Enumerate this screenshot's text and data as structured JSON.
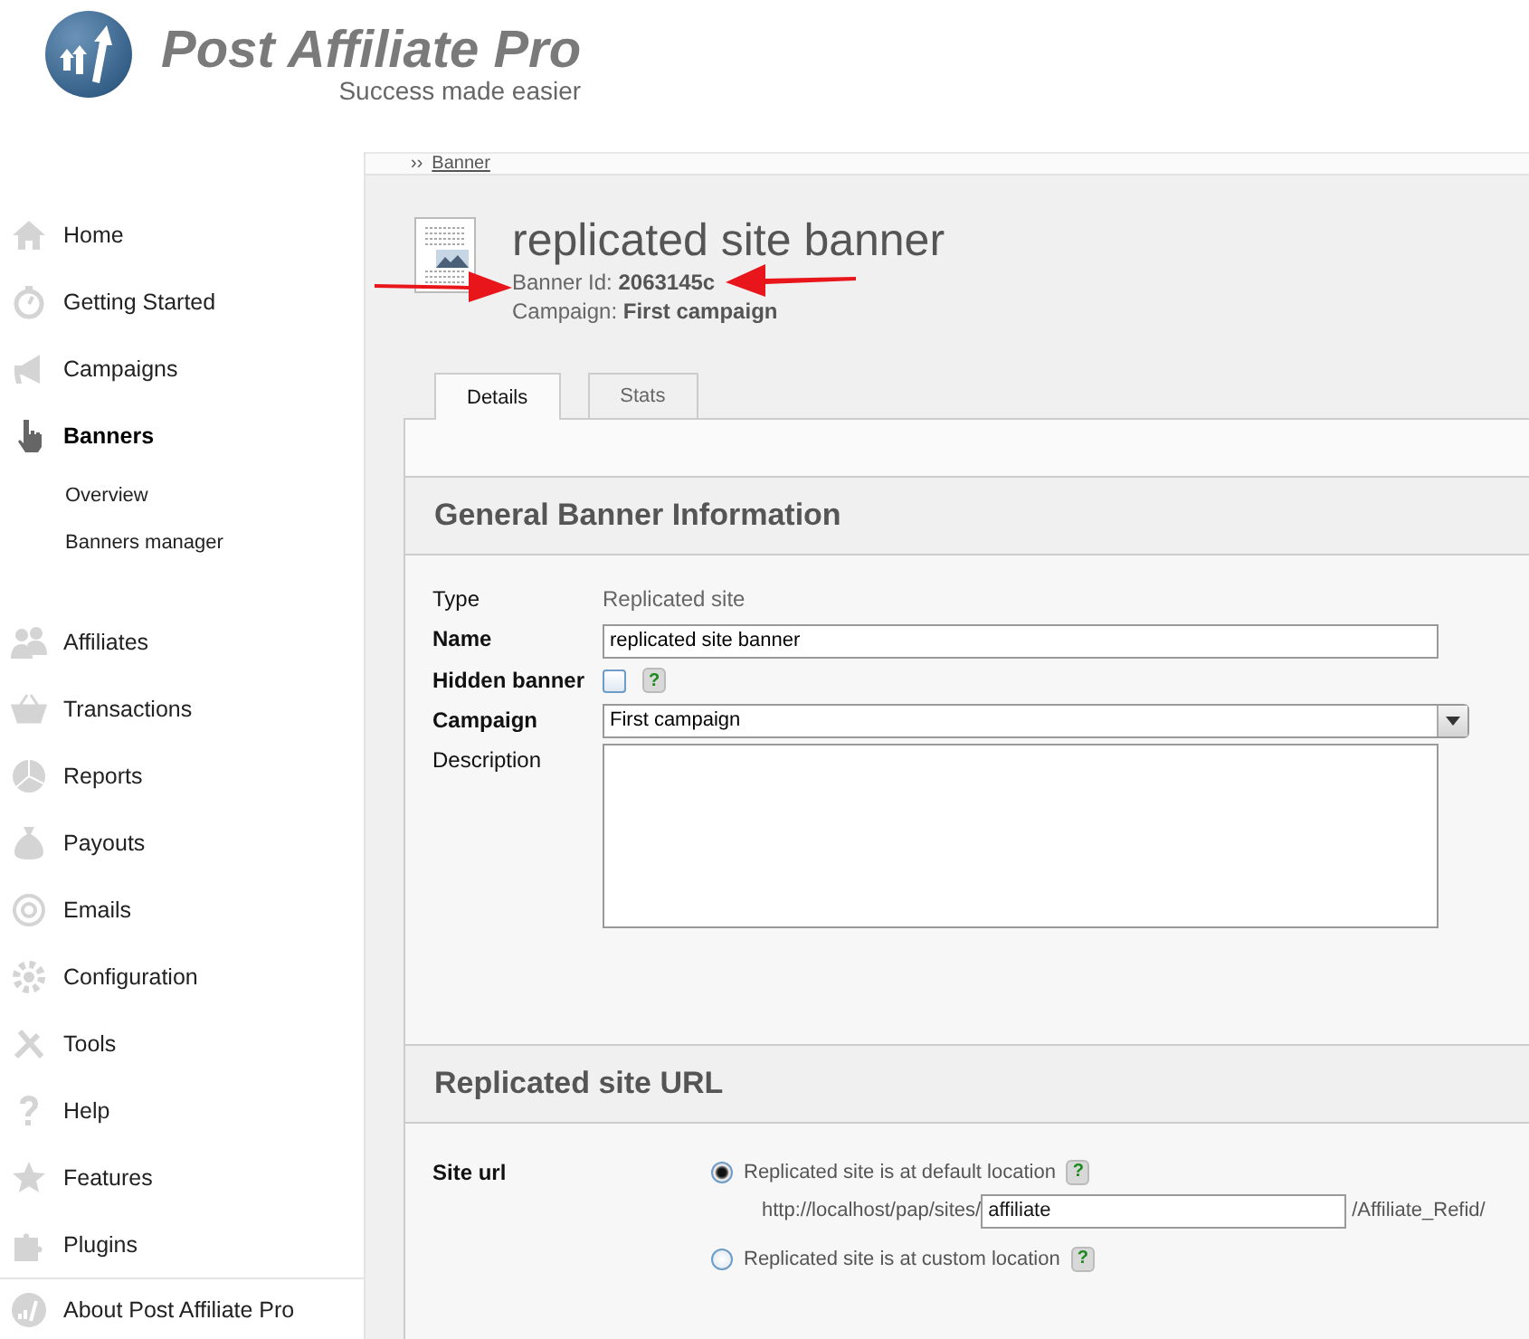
{
  "logo": {
    "title": "Post Affiliate Pro",
    "tagline": "Success made easier"
  },
  "sidebar": {
    "items": [
      {
        "label": "Home",
        "selected": false
      },
      {
        "label": "Getting Started",
        "selected": false
      },
      {
        "label": "Campaigns",
        "selected": false
      },
      {
        "label": "Banners",
        "selected": true,
        "expanded": true,
        "children": [
          {
            "label": "Overview"
          },
          {
            "label": "Banners manager"
          }
        ]
      },
      {
        "label": "Affiliates",
        "selected": false
      },
      {
        "label": "Transactions",
        "selected": false
      },
      {
        "label": "Reports",
        "selected": false
      },
      {
        "label": "Payouts",
        "selected": false
      },
      {
        "label": "Emails",
        "selected": false
      },
      {
        "label": "Configuration",
        "selected": false
      },
      {
        "label": "Tools",
        "selected": false
      },
      {
        "label": "Help",
        "selected": false
      },
      {
        "label": "Features",
        "selected": false
      },
      {
        "label": "Plugins",
        "selected": false
      }
    ],
    "footer_item": "About Post Affiliate Pro"
  },
  "breadcrumb": {
    "separator": "››",
    "link": "Banner"
  },
  "banner": {
    "title": "replicated site banner",
    "id_label": "Banner Id:",
    "id": "2063145c",
    "campaign_label": "Campaign:",
    "campaign": "First campaign"
  },
  "tabs": [
    {
      "label": "Details",
      "selected": true
    },
    {
      "label": "Stats",
      "selected": false
    }
  ],
  "sections": [
    {
      "title": "General Banner Information",
      "fields": [
        {
          "kind": "static",
          "label": "Type",
          "required": false,
          "value": "Replicated site"
        },
        {
          "kind": "text",
          "label": "Name",
          "required": true,
          "value": "replicated site banner"
        },
        {
          "kind": "checkbox",
          "label": "Hidden banner",
          "required": true,
          "checked": false,
          "help": "?"
        },
        {
          "kind": "select",
          "label": "Campaign",
          "required": true,
          "value": "First campaign"
        },
        {
          "kind": "textarea",
          "label": "Description",
          "required": false
        }
      ]
    },
    {
      "title": "Replicated site URL",
      "fields": [
        {
          "kind": "radios",
          "label": "Site url",
          "required": true,
          "options": [
            {
              "label": "Replicated site is at default location",
              "selected": true,
              "help": "?",
              "prefix": "http://localhost/pap/sites/",
              "value": "affiliate",
              "suffix": "/Affiliate_Refid/"
            },
            {
              "label": "Replicated site is at custom location",
              "selected": false,
              "help": "?"
            }
          ]
        }
      ]
    }
  ]
}
